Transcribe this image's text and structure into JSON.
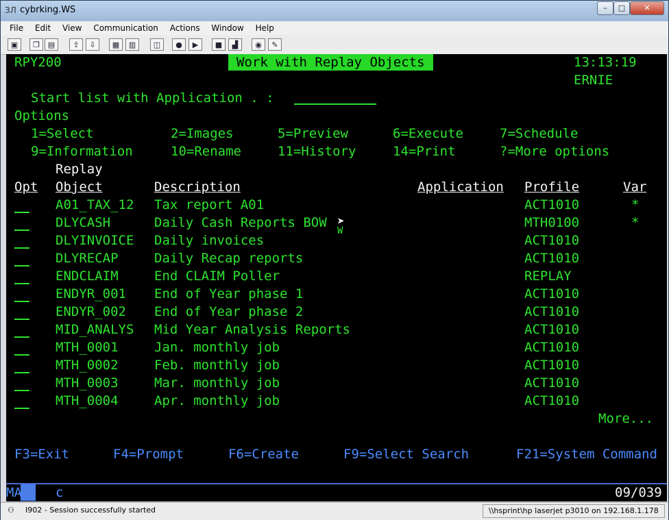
{
  "window": {
    "title": "cybrking.WS",
    "app_icon_label": "ЗЛ",
    "minimize": "–",
    "maximize": "□",
    "close": "✕"
  },
  "menu": [
    "File",
    "Edit",
    "View",
    "Communication",
    "Actions",
    "Window",
    "Help"
  ],
  "toolbar_icons": [
    "print-screen-icon",
    "copy-icon",
    "paste-icon",
    "send-icon",
    "receive-icon",
    "display-icon",
    "keyboard-icon",
    "macro-icon",
    "record-icon",
    "play-icon",
    "stop-icon",
    "chart-icon",
    "settings-icon",
    "globe-icon",
    "edit-icon"
  ],
  "screen": {
    "program_id": "RPY200",
    "title": "Work with Replay Objects",
    "time": "13:13:19",
    "user": "ERNIE",
    "start_list_label": "Start list with Application . :",
    "start_list_value": "",
    "options_label": "Options",
    "options_row1": [
      "1=Select",
      "2=Images",
      "5=Preview",
      "6=Execute",
      "7=Schedule"
    ],
    "options_row2": [
      "9=Information",
      "10=Rename",
      "11=History",
      "14=Print",
      "?=More options"
    ],
    "col_header_top": "Replay",
    "columns": {
      "opt": "Opt",
      "object": "Object",
      "description": "Description",
      "application": "Application",
      "profile": "Profile",
      "var": "Var"
    },
    "rows": [
      {
        "object": "A01_TAX_12",
        "description": "Tax report A01",
        "application": "",
        "profile": "ACT1010",
        "var": "*"
      },
      {
        "object": "DLYCASH",
        "description": "Daily Cash Reports BOW",
        "application": "",
        "profile": "MTH0100",
        "var": "*"
      },
      {
        "object": "DLYINVOICE",
        "description": "Daily invoices",
        "application": "",
        "profile": "ACT1010",
        "var": ""
      },
      {
        "object": "DLYRECAP",
        "description": "Daily Recap reports",
        "application": "",
        "profile": "ACT1010",
        "var": ""
      },
      {
        "object": "ENDCLAIM",
        "description": "End CLAIM Poller",
        "application": "",
        "profile": "REPLAY",
        "var": ""
      },
      {
        "object": "ENDYR_001",
        "description": "End of Year phase 1",
        "application": "",
        "profile": "ACT1010",
        "var": ""
      },
      {
        "object": "ENDYR_002",
        "description": "End of Year phase 2",
        "application": "",
        "profile": "ACT1010",
        "var": ""
      },
      {
        "object": "MID_ANALYS",
        "description": "Mid Year Analysis Reports",
        "application": "",
        "profile": "ACT1010",
        "var": ""
      },
      {
        "object": "MTH_0001",
        "description": "Jan. monthly job",
        "application": "",
        "profile": "ACT1010",
        "var": ""
      },
      {
        "object": "MTH_0002",
        "description": "Feb. monthly job",
        "application": "",
        "profile": "ACT1010",
        "var": ""
      },
      {
        "object": "MTH_0003",
        "description": "Mar. monthly job",
        "application": "",
        "profile": "ACT1010",
        "var": ""
      },
      {
        "object": "MTH_0004",
        "description": "Apr. monthly job",
        "application": "",
        "profile": "ACT1010",
        "var": ""
      }
    ],
    "more": "More...",
    "fkeys": [
      "F3=Exit",
      "F4=Prompt",
      "F6=Create",
      "F9=Select Search",
      "F21=System Command"
    ],
    "mouse_glyph_char": "W",
    "oia": {
      "mode": "MA",
      "indicator": "c",
      "position": "09/039"
    }
  },
  "status": {
    "message": "I902 - Session successfully started",
    "printer": "\\\\hsprint\\hp laserjet p3010 on 192.168.1.178"
  }
}
